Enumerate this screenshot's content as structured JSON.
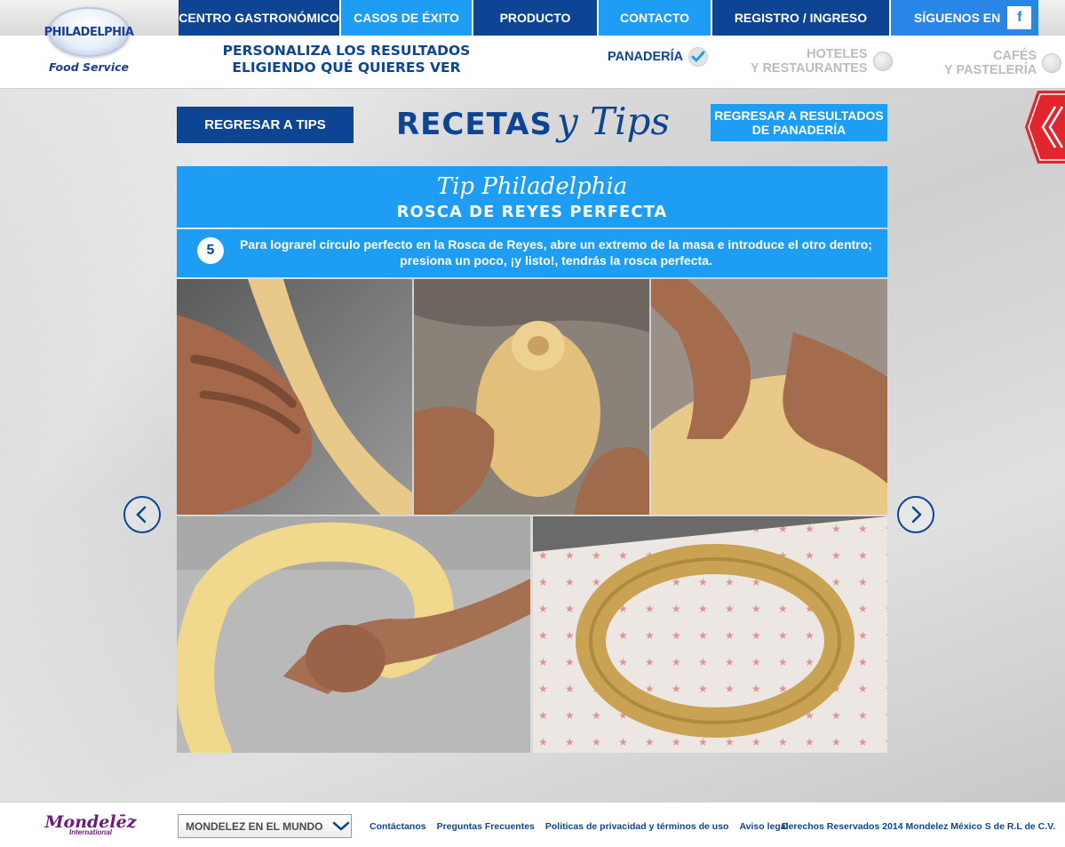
{
  "brand": {
    "name": "PHILADELPHIA",
    "subtitle": "Food Service"
  },
  "nav": {
    "items": [
      {
        "label": "CENTRO GASTRONÓMICO"
      },
      {
        "label": "CASOS DE ÉXITO"
      },
      {
        "label": "PRODUCTO"
      },
      {
        "label": "CONTACTO"
      },
      {
        "label": "REGISTRO / INGRESO"
      }
    ],
    "follow_label": "SÍGUENOS EN",
    "facebook_glyph": "f"
  },
  "personalize": {
    "line1": "PERSONALIZA LOS RESULTADOS",
    "line2": "ELIGIENDO QUÉ QUIERES VER"
  },
  "filters": [
    {
      "line1": "PANADERÍA",
      "line2": "",
      "selected": true
    },
    {
      "line1": "HOTELES",
      "line2": "Y RESTAURANTES",
      "selected": false
    },
    {
      "line1": "CAFÉS",
      "line2": "Y PASTELERÍA",
      "selected": false
    }
  ],
  "page": {
    "back_tips_label": "REGRESAR A TIPS",
    "title_word": "RECETAS",
    "title_script": "y Tips",
    "back_results_line1": "REGRESAR A RESULTADOS",
    "back_results_line2": "DE PANADERÍA"
  },
  "tip": {
    "script_title": "Tip Philadelphia",
    "title": "ROSCA DE REYES PERFECTA",
    "step_number": "5",
    "step_line1": "Para lograrel círculo perfecto en la Rosca de Reyes, abre un extremo de la masa e introduce el otro dentro;",
    "step_line2": "presiona un poco, ¡y listo!, tendrás la rosca perfecta."
  },
  "footer": {
    "brand_word": "Mondelēz",
    "brand_sub": "International",
    "world_select": "MONDELEZ EN EL MUNDO",
    "links": [
      "Contáctanos",
      "Preguntas Frecuentes",
      "Politicas de privacidad y términos de uso",
      "Aviso legal"
    ],
    "copyright": "Derechos Reservados 2014 Mondelez México S de R.L de C.V."
  },
  "colors": {
    "dark_blue": "#0d4594",
    "light_blue": "#1d9df3",
    "accent_red": "#e3262d",
    "mondelez_purple": "#6d1a7a"
  }
}
